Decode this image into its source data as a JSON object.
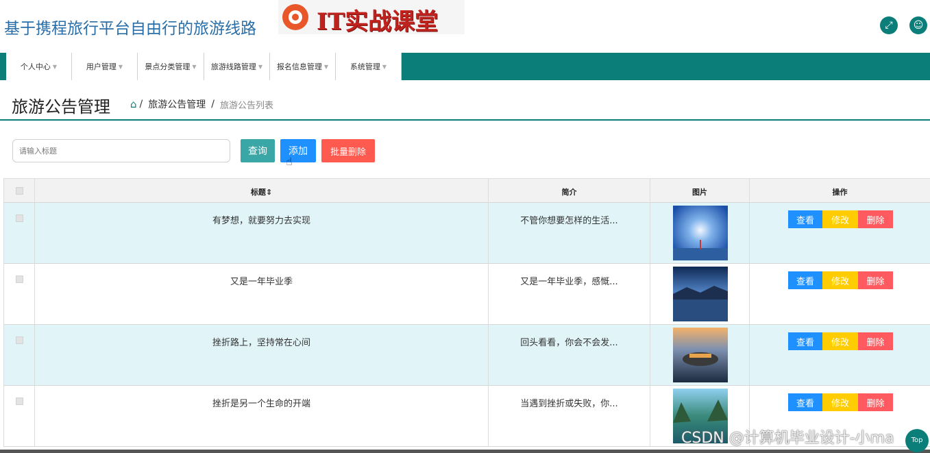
{
  "header": {
    "site_title": "基于携程旅行平台自由行的旅游线路",
    "logo_text": "IT实战课堂",
    "expand_icon": "expand-icon",
    "user_icon": "user-icon"
  },
  "nav": {
    "items": [
      {
        "label": "个人中心"
      },
      {
        "label": "用户管理"
      },
      {
        "label": "景点分类管理"
      },
      {
        "label": "旅游线路管理"
      },
      {
        "label": "报名信息管理"
      },
      {
        "label": "系统管理"
      }
    ]
  },
  "page": {
    "title": "旅游公告管理",
    "breadcrumb": {
      "parent": "旅游公告管理",
      "separator": "/",
      "current": "旅游公告列表"
    }
  },
  "toolbar": {
    "search_placeholder": "请输入标题",
    "query_label": "查询",
    "add_label": "添加",
    "bulk_delete_label": "批量删除"
  },
  "table": {
    "columns": {
      "title": "标题",
      "summary": "简介",
      "image": "图片",
      "actions": "操作"
    },
    "rows": [
      {
        "title": "有梦想，就要努力去实现",
        "summary": "不管你想要怎样的生活...",
        "view": "查看",
        "edit": "修改",
        "delete": "删除"
      },
      {
        "title": "又是一年毕业季",
        "summary": "又是一年毕业季，感慨...",
        "view": "查看",
        "edit": "修改",
        "delete": "删除"
      },
      {
        "title": "挫折路上，坚持常在心间",
        "summary": "回头看看，你会不会发...",
        "view": "查看",
        "edit": "修改",
        "delete": "删除"
      },
      {
        "title": "挫折是另一个生命的开端",
        "summary": "当遇到挫折或失败，你...",
        "view": "查看",
        "edit": "修改",
        "delete": "删除"
      }
    ]
  },
  "watermark": "CSDN @计算机毕业设计-小ma",
  "colors": {
    "primary": "#0b7e7a",
    "title_blue": "#2a6ea8",
    "add": "#1e90ff",
    "danger": "#ff5a4f",
    "edit": "#ffcc00",
    "row_alt": "#e1f4f8"
  }
}
